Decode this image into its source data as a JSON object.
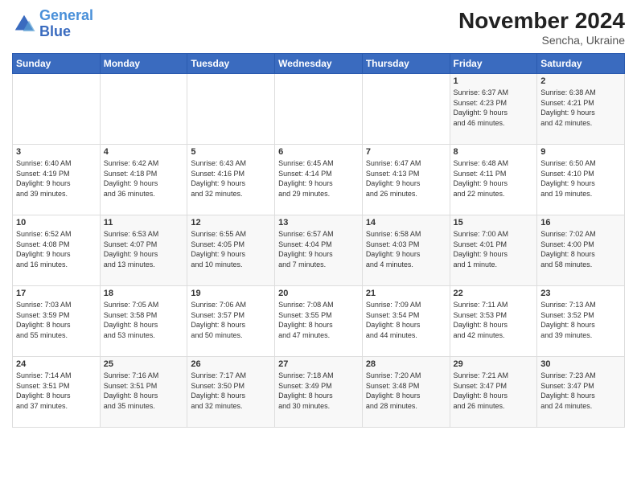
{
  "logo": {
    "line1": "General",
    "line2": "Blue"
  },
  "title": "November 2024",
  "subtitle": "Sencha, Ukraine",
  "days_header": [
    "Sunday",
    "Monday",
    "Tuesday",
    "Wednesday",
    "Thursday",
    "Friday",
    "Saturday"
  ],
  "weeks": [
    [
      {
        "day": "",
        "info": ""
      },
      {
        "day": "",
        "info": ""
      },
      {
        "day": "",
        "info": ""
      },
      {
        "day": "",
        "info": ""
      },
      {
        "day": "",
        "info": ""
      },
      {
        "day": "1",
        "info": "Sunrise: 6:37 AM\nSunset: 4:23 PM\nDaylight: 9 hours\nand 46 minutes."
      },
      {
        "day": "2",
        "info": "Sunrise: 6:38 AM\nSunset: 4:21 PM\nDaylight: 9 hours\nand 42 minutes."
      }
    ],
    [
      {
        "day": "3",
        "info": "Sunrise: 6:40 AM\nSunset: 4:19 PM\nDaylight: 9 hours\nand 39 minutes."
      },
      {
        "day": "4",
        "info": "Sunrise: 6:42 AM\nSunset: 4:18 PM\nDaylight: 9 hours\nand 36 minutes."
      },
      {
        "day": "5",
        "info": "Sunrise: 6:43 AM\nSunset: 4:16 PM\nDaylight: 9 hours\nand 32 minutes."
      },
      {
        "day": "6",
        "info": "Sunrise: 6:45 AM\nSunset: 4:14 PM\nDaylight: 9 hours\nand 29 minutes."
      },
      {
        "day": "7",
        "info": "Sunrise: 6:47 AM\nSunset: 4:13 PM\nDaylight: 9 hours\nand 26 minutes."
      },
      {
        "day": "8",
        "info": "Sunrise: 6:48 AM\nSunset: 4:11 PM\nDaylight: 9 hours\nand 22 minutes."
      },
      {
        "day": "9",
        "info": "Sunrise: 6:50 AM\nSunset: 4:10 PM\nDaylight: 9 hours\nand 19 minutes."
      }
    ],
    [
      {
        "day": "10",
        "info": "Sunrise: 6:52 AM\nSunset: 4:08 PM\nDaylight: 9 hours\nand 16 minutes."
      },
      {
        "day": "11",
        "info": "Sunrise: 6:53 AM\nSunset: 4:07 PM\nDaylight: 9 hours\nand 13 minutes."
      },
      {
        "day": "12",
        "info": "Sunrise: 6:55 AM\nSunset: 4:05 PM\nDaylight: 9 hours\nand 10 minutes."
      },
      {
        "day": "13",
        "info": "Sunrise: 6:57 AM\nSunset: 4:04 PM\nDaylight: 9 hours\nand 7 minutes."
      },
      {
        "day": "14",
        "info": "Sunrise: 6:58 AM\nSunset: 4:03 PM\nDaylight: 9 hours\nand 4 minutes."
      },
      {
        "day": "15",
        "info": "Sunrise: 7:00 AM\nSunset: 4:01 PM\nDaylight: 9 hours\nand 1 minute."
      },
      {
        "day": "16",
        "info": "Sunrise: 7:02 AM\nSunset: 4:00 PM\nDaylight: 8 hours\nand 58 minutes."
      }
    ],
    [
      {
        "day": "17",
        "info": "Sunrise: 7:03 AM\nSunset: 3:59 PM\nDaylight: 8 hours\nand 55 minutes."
      },
      {
        "day": "18",
        "info": "Sunrise: 7:05 AM\nSunset: 3:58 PM\nDaylight: 8 hours\nand 53 minutes."
      },
      {
        "day": "19",
        "info": "Sunrise: 7:06 AM\nSunset: 3:57 PM\nDaylight: 8 hours\nand 50 minutes."
      },
      {
        "day": "20",
        "info": "Sunrise: 7:08 AM\nSunset: 3:55 PM\nDaylight: 8 hours\nand 47 minutes."
      },
      {
        "day": "21",
        "info": "Sunrise: 7:09 AM\nSunset: 3:54 PM\nDaylight: 8 hours\nand 44 minutes."
      },
      {
        "day": "22",
        "info": "Sunrise: 7:11 AM\nSunset: 3:53 PM\nDaylight: 8 hours\nand 42 minutes."
      },
      {
        "day": "23",
        "info": "Sunrise: 7:13 AM\nSunset: 3:52 PM\nDaylight: 8 hours\nand 39 minutes."
      }
    ],
    [
      {
        "day": "24",
        "info": "Sunrise: 7:14 AM\nSunset: 3:51 PM\nDaylight: 8 hours\nand 37 minutes."
      },
      {
        "day": "25",
        "info": "Sunrise: 7:16 AM\nSunset: 3:51 PM\nDaylight: 8 hours\nand 35 minutes."
      },
      {
        "day": "26",
        "info": "Sunrise: 7:17 AM\nSunset: 3:50 PM\nDaylight: 8 hours\nand 32 minutes."
      },
      {
        "day": "27",
        "info": "Sunrise: 7:18 AM\nSunset: 3:49 PM\nDaylight: 8 hours\nand 30 minutes."
      },
      {
        "day": "28",
        "info": "Sunrise: 7:20 AM\nSunset: 3:48 PM\nDaylight: 8 hours\nand 28 minutes."
      },
      {
        "day": "29",
        "info": "Sunrise: 7:21 AM\nSunset: 3:47 PM\nDaylight: 8 hours\nand 26 minutes."
      },
      {
        "day": "30",
        "info": "Sunrise: 7:23 AM\nSunset: 3:47 PM\nDaylight: 8 hours\nand 24 minutes."
      }
    ]
  ]
}
